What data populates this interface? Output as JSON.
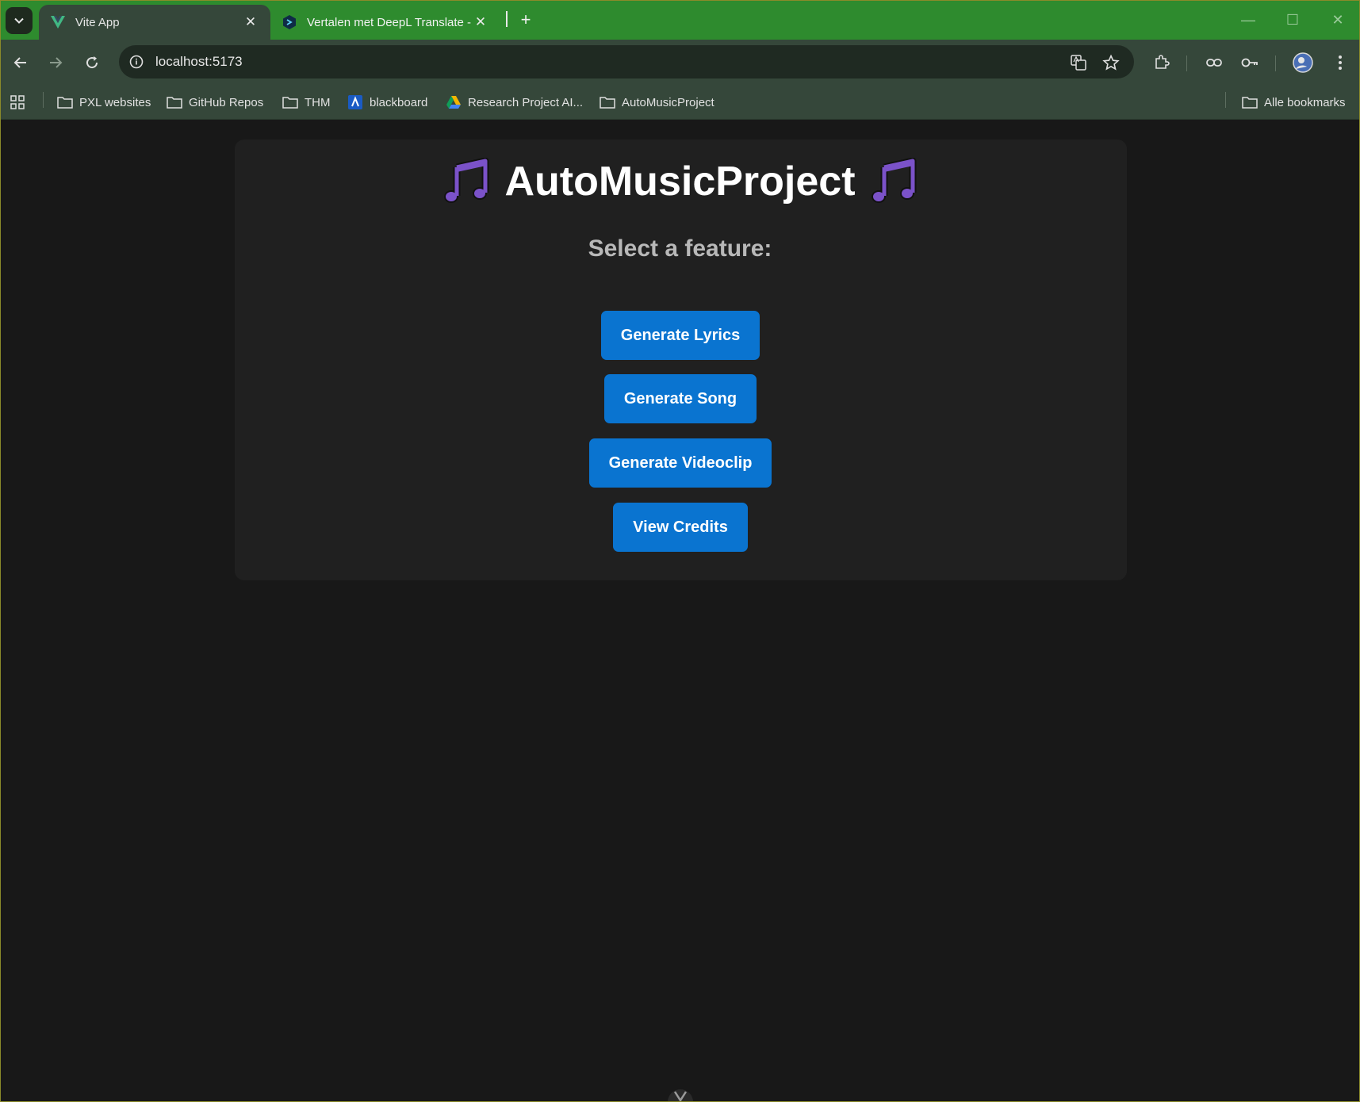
{
  "browser": {
    "tabs": [
      {
        "title": "Vite App",
        "active": true,
        "favicon": "vite-icon"
      },
      {
        "title": "Vertalen met DeepL Translate -",
        "active": false,
        "favicon": "deepl-icon"
      }
    ],
    "close_glyph": "✕",
    "new_tab_glyph": "+",
    "window_controls": {
      "minimize": "—",
      "maximize": "☐",
      "close": "✕"
    },
    "address": {
      "url": "localhost:5173"
    },
    "bookmarks": [
      {
        "label": "PXL websites",
        "icon": "folder-icon"
      },
      {
        "label": "GitHub Repos",
        "icon": "folder-icon"
      },
      {
        "label": "THM",
        "icon": "folder-icon"
      },
      {
        "label": "blackboard",
        "icon": "blackboard-icon"
      },
      {
        "label": "Research Project AI...",
        "icon": "google-drive-icon"
      },
      {
        "label": "AutoMusicProject",
        "icon": "folder-icon"
      }
    ],
    "all_bookmarks": "Alle bookmarks"
  },
  "page": {
    "title": "AutoMusicProject",
    "subtitle": "Select a feature:",
    "buttons": {
      "lyrics": "Generate Lyrics",
      "song": "Generate Song",
      "videoclip": "Generate Videoclip",
      "credits": "View Credits"
    }
  },
  "colors": {
    "tab_strip": "#2e8b2e",
    "toolbar": "#35473a",
    "page_bg": "#181818",
    "card_bg": "#202020",
    "button_bg": "#0a74d0",
    "note_icon": "#7b52c9"
  }
}
